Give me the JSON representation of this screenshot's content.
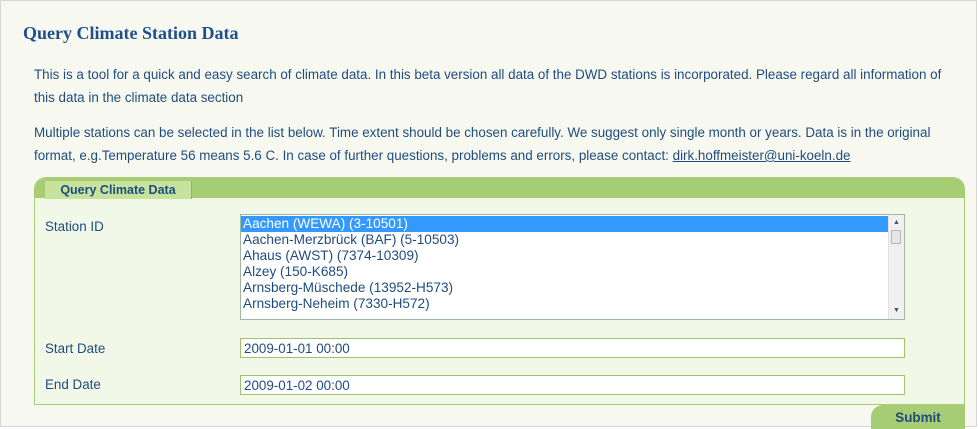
{
  "page": {
    "title": "Query Climate Station Data",
    "intro_1": "This is a tool for a quick and easy search of climate data. In this beta version all data of the DWD stations is incorporated. Please regard all information of this data in the climate data section",
    "intro_2": "Multiple stations can be selected in the list below. Time extent should be chosen carefully. We suggest only single month or years. Data is in the original format, e.g.Temperature 56 means 5.6 C. In case of further questions, problems and errors, please contact:",
    "contact_email": "dirk.hoffmeister@uni-koeln.de"
  },
  "form": {
    "tab_label": "Query Climate Data",
    "station_label": "Station ID",
    "stations": [
      "Aachen (WEWA) (3-10501)",
      "Aachen-Merzbrück (BAF) (5-10503)",
      "Ahaus (AWST) (7374-10309)",
      "Alzey (150-K685)",
      "Arnsberg-Müschede (13952-H573)",
      "Arnsberg-Neheim (7330-H572)"
    ],
    "selected_station": "Aachen (WEWA) (3-10501)",
    "start_label": "Start Date",
    "start_value": "2009-01-01 00:00",
    "end_label": "End Date",
    "end_value": "2009-01-02 00:00",
    "submit_label": "Submit"
  },
  "icons": {
    "scroll_up": "triangle-up-icon",
    "scroll_down": "triangle-down-icon"
  },
  "colors": {
    "heading": "#1f4e8c",
    "text": "#1f4c7e",
    "panel_header": "#a7cd74",
    "selection": "#3399ff"
  }
}
